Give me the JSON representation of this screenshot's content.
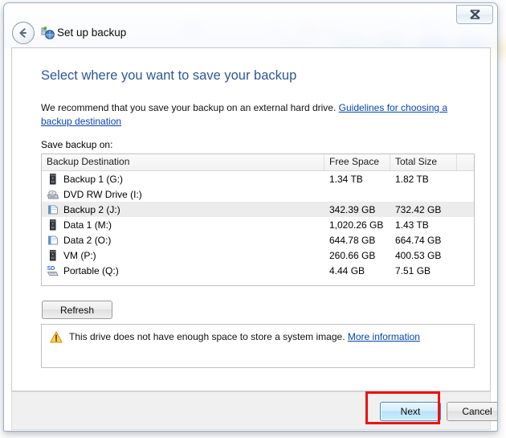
{
  "window": {
    "title": "Set up backup",
    "title_icon": "backup-globe-icon",
    "back_button_icon": "back-arrow-icon",
    "close_button_icon": "close-icon"
  },
  "content": {
    "heading": "Select where you want to save your backup",
    "recommend_text": "We recommend that you save your backup on an external hard drive.",
    "recommend_link": "Guidelines for choosing a backup destination",
    "save_label": "Save backup on:"
  },
  "list": {
    "columns": [
      "Backup Destination",
      "Free Space",
      "Total Size",
      ""
    ],
    "rows": [
      {
        "name": "Backup 1 (G:)",
        "free": "1.34 TB",
        "total": "1.82 TB",
        "icon": "external-drive-icon",
        "selected": false
      },
      {
        "name": "DVD RW Drive (I:)",
        "free": "",
        "total": "",
        "icon": "dvd-drive-icon",
        "selected": false
      },
      {
        "name": "Backup 2 (J:)",
        "free": "342.39 GB",
        "total": "732.42 GB",
        "icon": "local-disk-icon",
        "selected": true
      },
      {
        "name": "Data 1 (M:)",
        "free": "1,020.26 GB",
        "total": "1.43 TB",
        "icon": "external-drive-icon",
        "selected": false
      },
      {
        "name": "Data 2 (O:)",
        "free": "644.78 GB",
        "total": "664.74 GB",
        "icon": "local-disk-icon",
        "selected": false
      },
      {
        "name": "VM (P:)",
        "free": "260.66 GB",
        "total": "400.53 GB",
        "icon": "external-drive-icon",
        "selected": false
      },
      {
        "name": "Portable (Q:)",
        "free": "4.44 GB",
        "total": "7.51 GB",
        "icon": "sd-card-icon",
        "selected": false
      }
    ]
  },
  "refresh": {
    "label": "Refresh"
  },
  "warning": {
    "icon": "warning-triangle-icon",
    "text": "This drive does not have enough space to store a system image.",
    "link": "More information"
  },
  "footer": {
    "next_label": "Next",
    "cancel_label": "Cancel"
  },
  "annotation": {
    "color": "#ee1111",
    "target": "next-button"
  }
}
